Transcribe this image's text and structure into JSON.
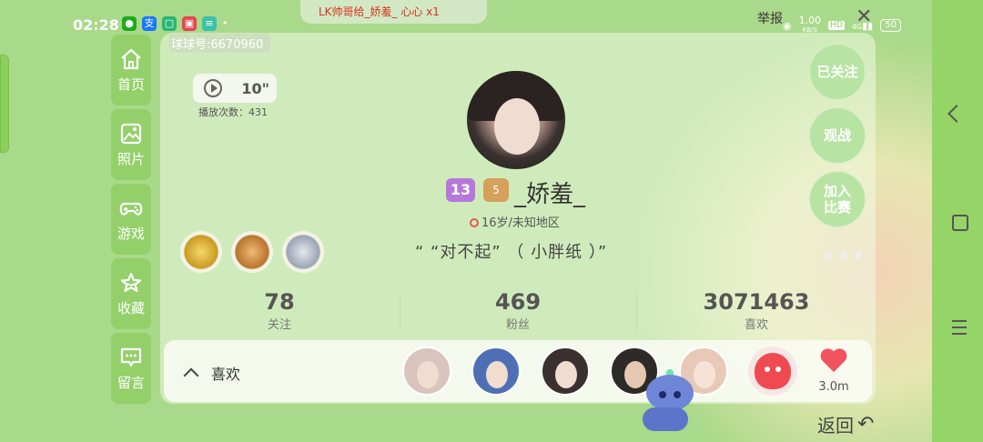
{
  "status_bar": {
    "time": "02:28",
    "net_speed": "1.00",
    "net_unit": "KB/S",
    "hd_badge": "HD",
    "signal_label": "4G",
    "battery": "50"
  },
  "notification_banner": "LK帅哥给_娇羞_ 心心 x1",
  "report_label": "举报",
  "profile": {
    "qiuqiu_id": "球球号:6670960",
    "video_length": "10\"",
    "play_count": "播放次数：431",
    "level": "13",
    "rank_badge": "5",
    "username": "_娇羞_",
    "age_location": "16岁/未知地区",
    "signature": "“ “对不起” （ 小胖纸 ）”"
  },
  "sidebar": {
    "items": [
      {
        "label": "首页",
        "icon": "home-icon"
      },
      {
        "label": "照片",
        "icon": "photo-icon"
      },
      {
        "label": "游戏",
        "icon": "gamepad-icon"
      },
      {
        "label": "收藏",
        "icon": "star-icon"
      },
      {
        "label": "留言",
        "icon": "message-icon"
      }
    ]
  },
  "stats": [
    {
      "value": "78",
      "label": "关注"
    },
    {
      "value": "469",
      "label": "粉丝"
    },
    {
      "value": "3071463",
      "label": "喜欢"
    }
  ],
  "likes_section": {
    "label": "喜欢",
    "heart_count": "3.0m"
  },
  "actions": {
    "follow": "已关注",
    "watch": "观战",
    "join_line1": "加入",
    "join_line2": "比赛",
    "more": "•••"
  },
  "back_label": "返回",
  "colors": {
    "nav_bg": "#93d06a",
    "accent_red": "#f0525e",
    "level_purple": "#b678d8"
  }
}
